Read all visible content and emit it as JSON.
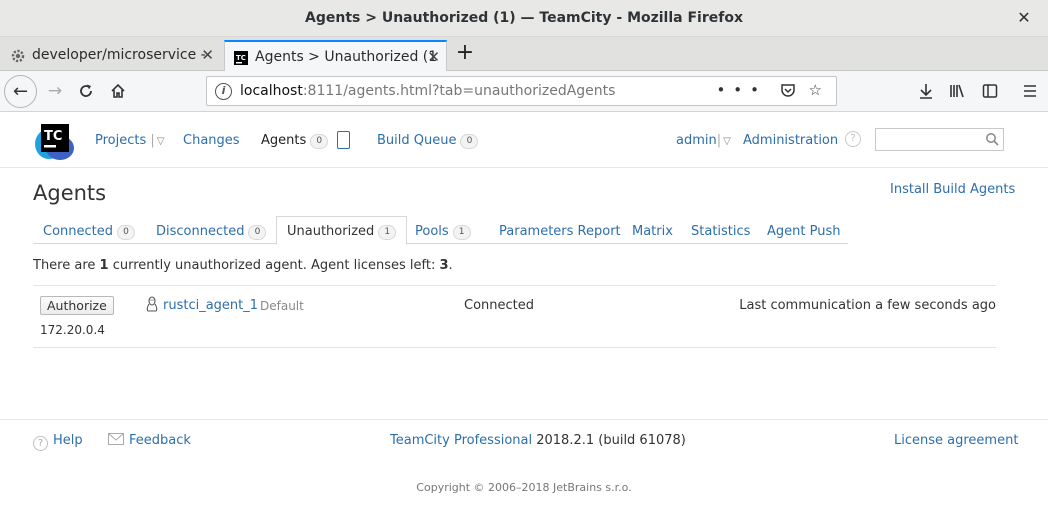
{
  "window": {
    "title": "Agents > Unauthorized (1) — TeamCity - Mozilla Firefox"
  },
  "browser": {
    "tabs": [
      {
        "label": "developer/microservice -",
        "icon": "gear-icon"
      },
      {
        "label": "Agents > Unauthorized (1",
        "icon": "teamcity-icon"
      }
    ],
    "url_host": "localhost",
    "url_rest": ":8111/agents.html?tab=unauthorizedAgents"
  },
  "header": {
    "logo_text": "TC",
    "nav": {
      "projects": "Projects",
      "changes": "Changes",
      "agents": "Agents",
      "agents_count": "0",
      "build_queue": "Build Queue",
      "build_queue_count": "0"
    },
    "user": "admin",
    "administration": "Administration",
    "help": "?",
    "search_placeholder": ""
  },
  "page": {
    "title": "Agents",
    "install_link": "Install Build Agents",
    "tabs": [
      {
        "label": "Connected",
        "count": "0"
      },
      {
        "label": "Disconnected",
        "count": "0"
      },
      {
        "label": "Unauthorized",
        "count": "1"
      },
      {
        "label": "Pools",
        "count": "1"
      },
      {
        "label": "Parameters Report"
      },
      {
        "label": "Matrix"
      },
      {
        "label": "Statistics"
      },
      {
        "label": "Agent Push"
      }
    ],
    "summary": {
      "pre": "There are ",
      "count": "1",
      "mid": " currently unauthorized agent. Agent licenses left: ",
      "licenses_left": "3",
      "post": "."
    },
    "agents": [
      {
        "authorize_label": "Authorize",
        "ip": "172.20.0.4",
        "os": "linux-icon",
        "name": "rustci_agent_1",
        "pool": "Default",
        "status": "Connected",
        "last_communication": "Last communication a few seconds ago"
      }
    ]
  },
  "footer": {
    "help": "Help",
    "feedback": "Feedback",
    "product": "TeamCity Professional",
    "version": " 2018.2.1 (build 61078)",
    "license": "License agreement",
    "copyright": "Copyright © 2006–2018 JetBrains s.r.o."
  },
  "colors": {
    "link": "#2d6eab",
    "firefox_accent": "#0a84ff"
  }
}
